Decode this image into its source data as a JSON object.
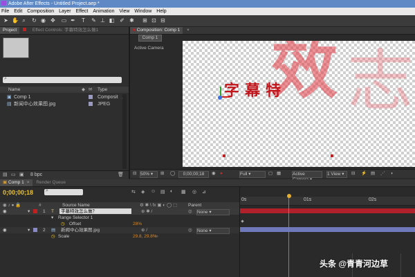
{
  "window": {
    "title": "Adobe After Effects - Untitled Project.aep *"
  },
  "menu": [
    "File",
    "Edit",
    "Composition",
    "Layer",
    "Effect",
    "Animation",
    "View",
    "Window",
    "Help"
  ],
  "project_panel": {
    "tab_project": "Project",
    "tab_effect_controls": "Effect Controls: 字幕特效怎么做1",
    "search_placeholder": "",
    "col_name": "Name",
    "col_type": "Type",
    "items": [
      {
        "name": "Comp 1",
        "type": "Composit"
      },
      {
        "name": "新闻中心效果图.jpg",
        "type": "JPEG"
      }
    ],
    "bpc": "8 bpc"
  },
  "comp_panel": {
    "tab": "Composition: Comp 1",
    "comp_button": "Comp 1",
    "active_camera_label": "Active Camera",
    "layer_text": "字幕特",
    "bg_glyph_1": "效",
    "bg_glyph_2": "志",
    "zoom": "50%",
    "timecode": "0;00;00;18",
    "resolution": "Full",
    "camera": "Active Camera",
    "views": "1 View"
  },
  "timeline": {
    "tab_comp": "Comp 1",
    "tab_render": "Render Queue",
    "current_time": "0;00;00;18",
    "col_source": "Source Name",
    "col_parent": "Parent",
    "ruler": [
      "0s",
      "01s",
      "02s"
    ],
    "layers": [
      {
        "num": "1",
        "name": "字幕特效怎么做？",
        "parent": "None"
      },
      {
        "num": "2",
        "name": "新闻中心效果图.jpg",
        "parent": "None"
      }
    ],
    "range_selector": "Range Selector 1",
    "offset_label": "Offset",
    "offset_value": "28%",
    "scale_label": "Scale",
    "scale_value": "29.8, 29.8%"
  },
  "watermark": "头条 @青青河边草",
  "colors": {
    "titlebar": "#5f89c4",
    "text_red": "#c0161c",
    "track_red": "#b0202a",
    "track_blue": "#6f78b8",
    "playhead": "#e06a10"
  }
}
